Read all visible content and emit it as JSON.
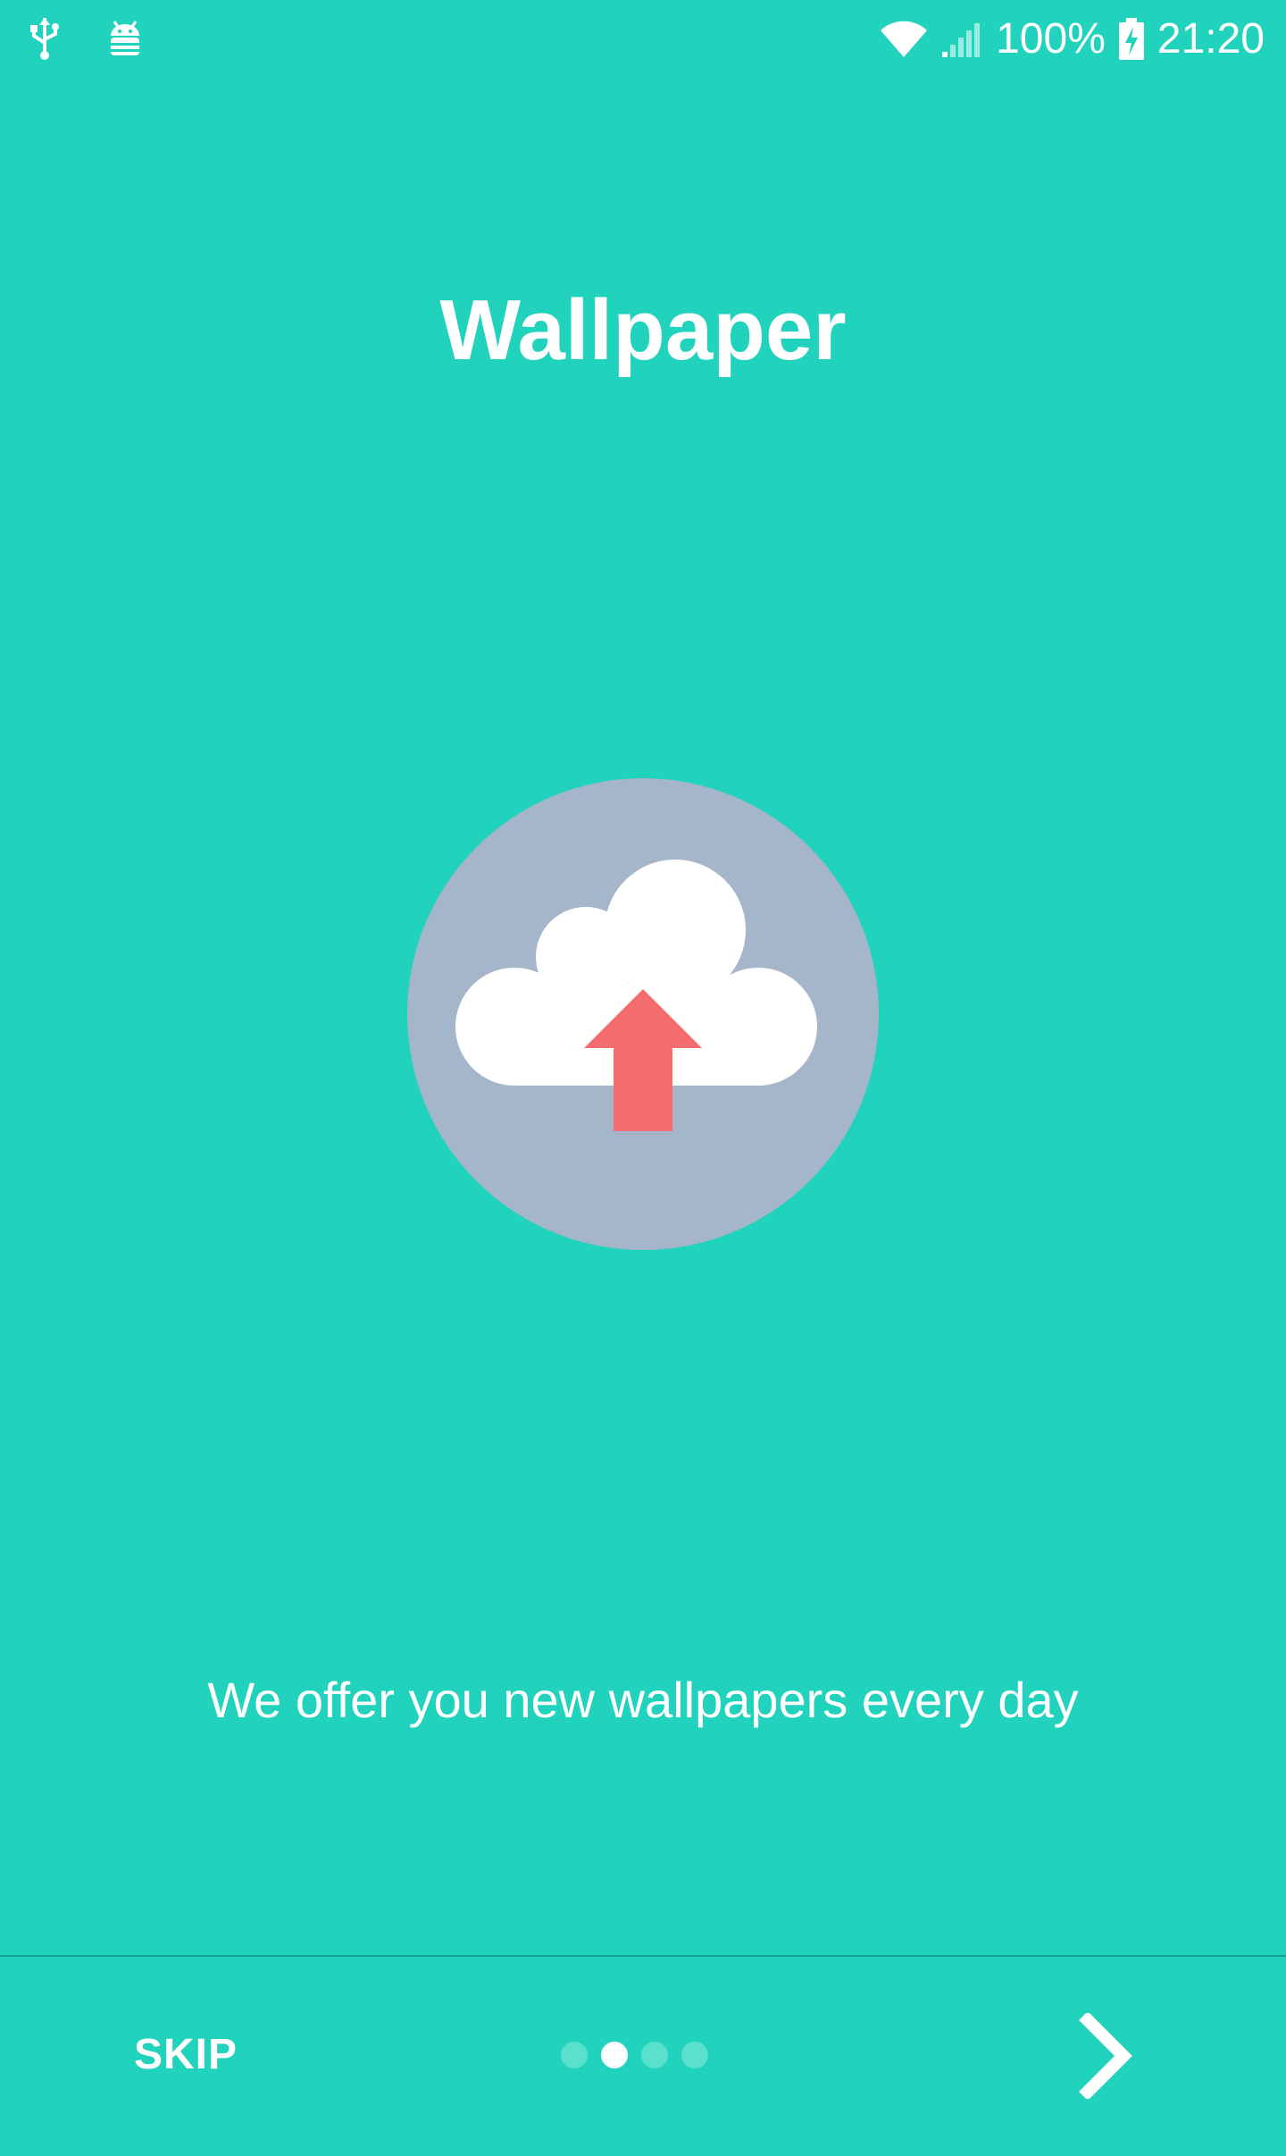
{
  "status_bar": {
    "left_icons": [
      "usb-icon",
      "android-debug-icon"
    ],
    "right_icons": [
      "wifi-icon",
      "cell-signal-icon",
      "battery-charging-icon"
    ],
    "battery": "100%",
    "time": "21:20"
  },
  "onboarding": {
    "title": "Wallpaper",
    "illustration_icon": "cloud-upload-icon",
    "description": "We offer you new wallpapers every day",
    "page_indicator": {
      "total": 4,
      "active_index": 1
    }
  },
  "bottom_bar": {
    "skip_label": "SKIP",
    "next_icon": "chevron-right-icon"
  },
  "colors": {
    "background": "#21D2BC",
    "circle": "#A5B5CA",
    "cloud": "#FFFFFF",
    "arrow": "#F56E6E",
    "dot_inactive": "#5CE0CE",
    "dot_active": "#FFFFFF"
  }
}
